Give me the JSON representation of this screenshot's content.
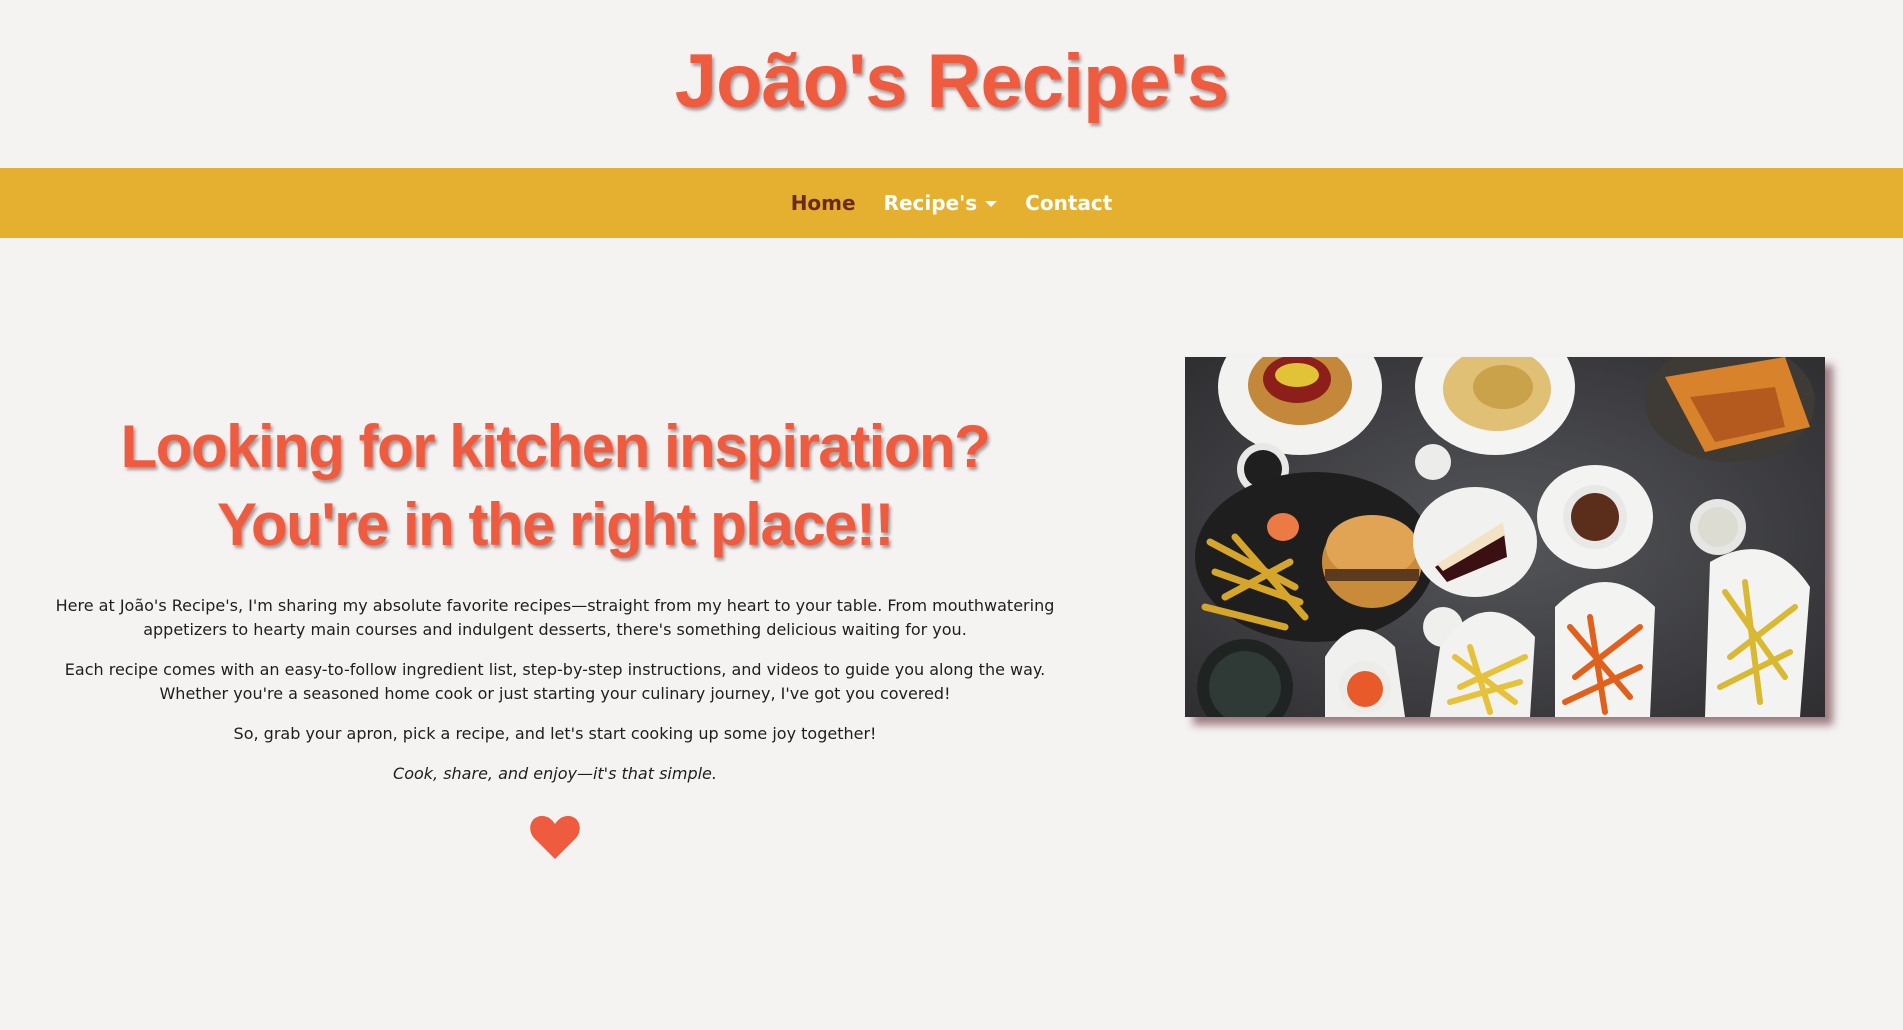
{
  "site": {
    "title": "João's Recipe's",
    "colors": {
      "brand": "#ef5b3f",
      "navbar": "#e5b02f",
      "nav_active": "#6b2a1c",
      "background": "#f5f3f2"
    }
  },
  "nav": {
    "items": [
      {
        "label": "Home",
        "active": true
      },
      {
        "label": "Recipe's",
        "dropdown": true
      },
      {
        "label": "Contact"
      }
    ]
  },
  "intro": {
    "headline": "Looking for kitchen inspiration? You're in the right place!!",
    "paragraphs": [
      "Here at João's Recipe's, I'm sharing my absolute favorite recipes—straight from my heart to your table. From mouthwatering appetizers to hearty main courses and indulgent desserts, there's something delicious waiting for you.",
      "Each recipe comes with an easy-to-follow ingredient list, step-by-step instructions, and videos to guide you along the way. Whether you're a seasoned home cook or just starting your culinary journey, I've got you covered!",
      "So, grab your apron, pick a recipe, and let's start cooking up some joy together!"
    ],
    "tagline": "Cook, share, and enjoy—it's that simple.",
    "icon": "heart-icon"
  },
  "hero_image": {
    "icon": "food-photo"
  }
}
